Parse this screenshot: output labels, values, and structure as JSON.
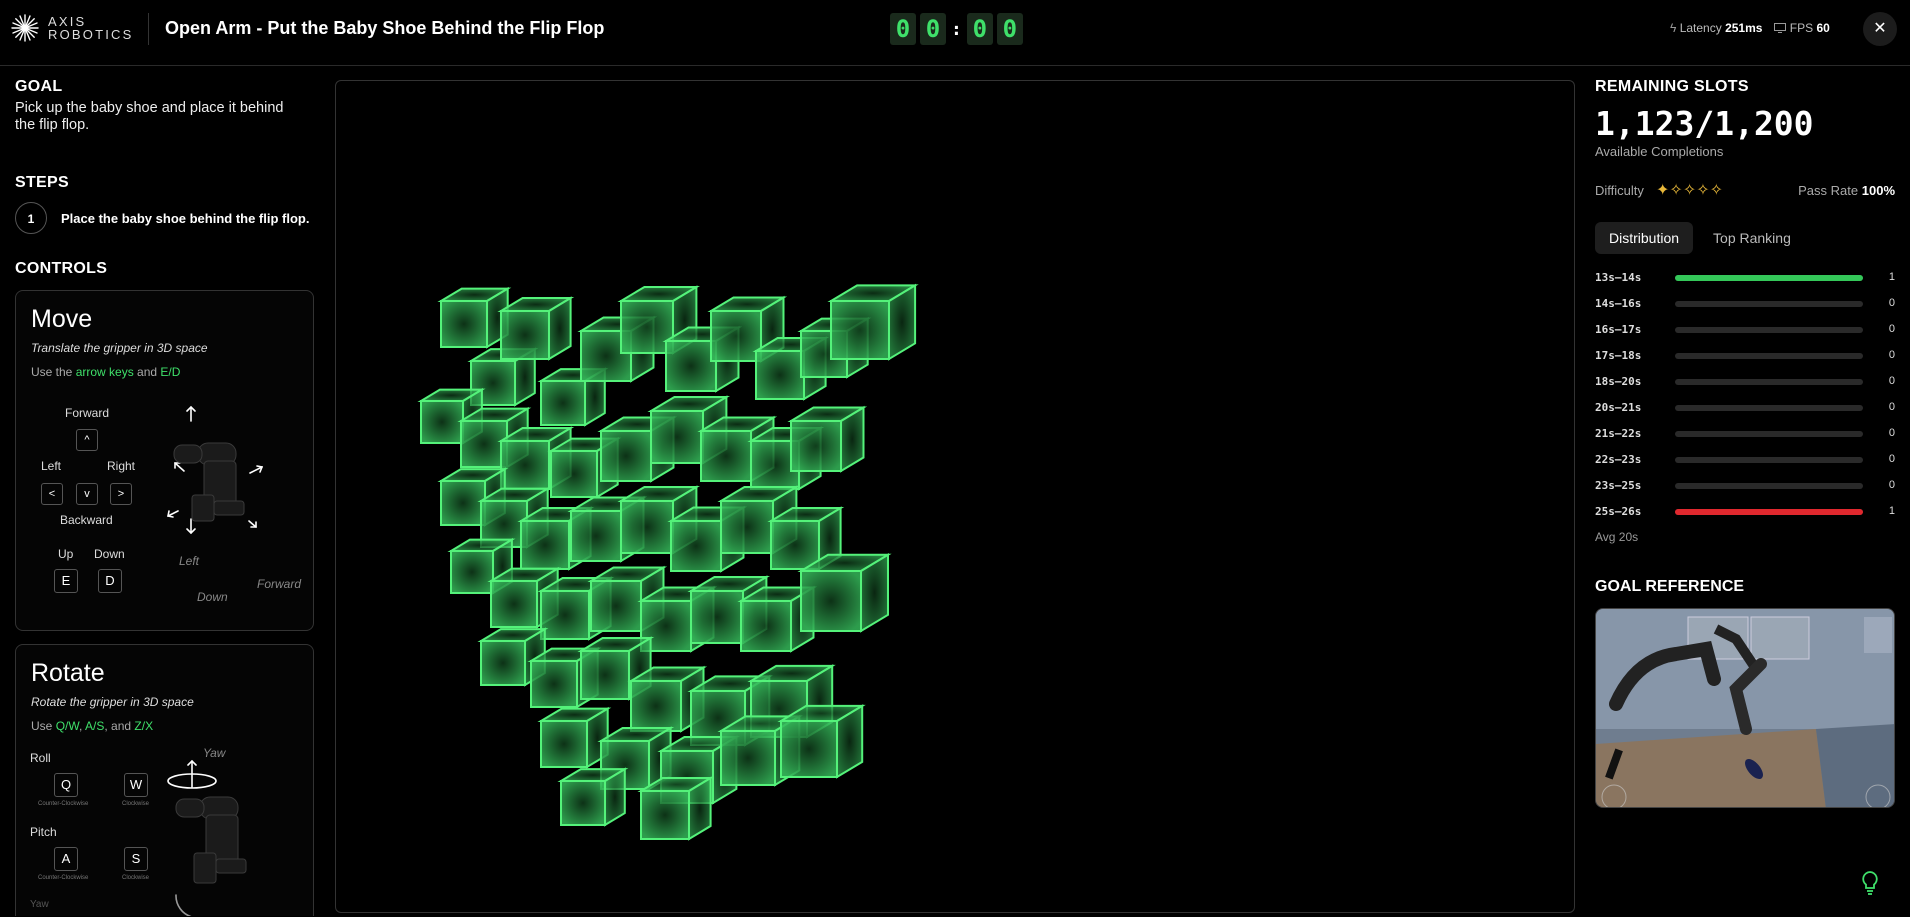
{
  "header": {
    "brand": [
      "AXIS",
      "ROBOTICS"
    ],
    "title": "Open Arm - Put the Baby Shoe Behind the Flip Flop",
    "timer_digits": [
      "0",
      "0",
      "0",
      "0"
    ],
    "timer_sep": ":",
    "latency_label": "Latency",
    "latency_value": "251ms",
    "fps_label": "FPS",
    "fps_value": "60",
    "close_icon": "close-icon"
  },
  "goal": {
    "title": "GOAL",
    "text": "Pick up the baby shoe and place it behind the flip flop."
  },
  "steps": {
    "title": "STEPS",
    "items": [
      {
        "num": "1",
        "text": "Place the baby shoe behind the flip flop."
      }
    ]
  },
  "controls": {
    "title": "CONTROLS",
    "move": {
      "title": "Move",
      "subtitle": "Translate the gripper in 3D space",
      "hint_prefix": "Use the ",
      "hint_k1": "arrow keys",
      "hint_mid": " and ",
      "hint_k2": "E/D",
      "forward": "Forward",
      "left": "Left",
      "right": "Right",
      "backward": "Backward",
      "up": "Up",
      "down": "Down",
      "key_up": "^",
      "key_left": "<",
      "key_down": "v",
      "key_right": ">",
      "key_e": "E",
      "key_d": "D",
      "diagram_left": "Left",
      "diagram_down": "Down",
      "diagram_forward": "Forward"
    },
    "rotate": {
      "title": "Rotate",
      "subtitle": "Rotate the gripper in 3D space",
      "hint_prefix": "Use ",
      "hint_k1": "Q/W",
      "hint_sep": ", ",
      "hint_k2": "A/S",
      "hint_mid": ", and ",
      "hint_k3": "Z/X",
      "yaw": "Yaw",
      "roll": "Roll",
      "pitch": "Pitch",
      "yaw_cut": "Yaw",
      "key_q": "Q",
      "key_w": "W",
      "key_a": "A",
      "key_s": "S",
      "ccw": "Counter-Clockwise",
      "cw": "Clockwise"
    }
  },
  "slots": {
    "title": "REMAINING SLOTS",
    "count": "1,123/1,200",
    "caption": "Available Completions",
    "difficulty_label": "Difficulty",
    "difficulty_stars": "✦✧✧✧✧",
    "difficulty_level": 1,
    "pass_label": "Pass Rate",
    "pass_value": "100%"
  },
  "tabs": [
    "Distribution",
    "Top Ranking"
  ],
  "distribution": [
    {
      "label": "13s–14s",
      "count": "1",
      "fraction": 1.0,
      "color": "#34c759"
    },
    {
      "label": "14s–16s",
      "count": "0",
      "fraction": 0,
      "color": "#34c759"
    },
    {
      "label": "16s–17s",
      "count": "0",
      "fraction": 0,
      "color": "#34c759"
    },
    {
      "label": "17s–18s",
      "count": "0",
      "fraction": 0,
      "color": "#34c759"
    },
    {
      "label": "18s–20s",
      "count": "0",
      "fraction": 0,
      "color": "#34c759"
    },
    {
      "label": "20s–21s",
      "count": "0",
      "fraction": 0,
      "color": "#34c759"
    },
    {
      "label": "21s–22s",
      "count": "0",
      "fraction": 0,
      "color": "#34c759"
    },
    {
      "label": "22s–23s",
      "count": "0",
      "fraction": 0,
      "color": "#34c759"
    },
    {
      "label": "23s–25s",
      "count": "0",
      "fraction": 0,
      "color": "#34c759"
    },
    {
      "label": "25s–26s",
      "count": "1",
      "fraction": 1.0,
      "color": "#e0282e"
    }
  ],
  "avg": "Avg 20s",
  "goal_reference": {
    "title": "GOAL REFERENCE"
  },
  "colors": {
    "accent": "#3fe06a",
    "star": "#e8b83a",
    "danger": "#e0282e"
  }
}
